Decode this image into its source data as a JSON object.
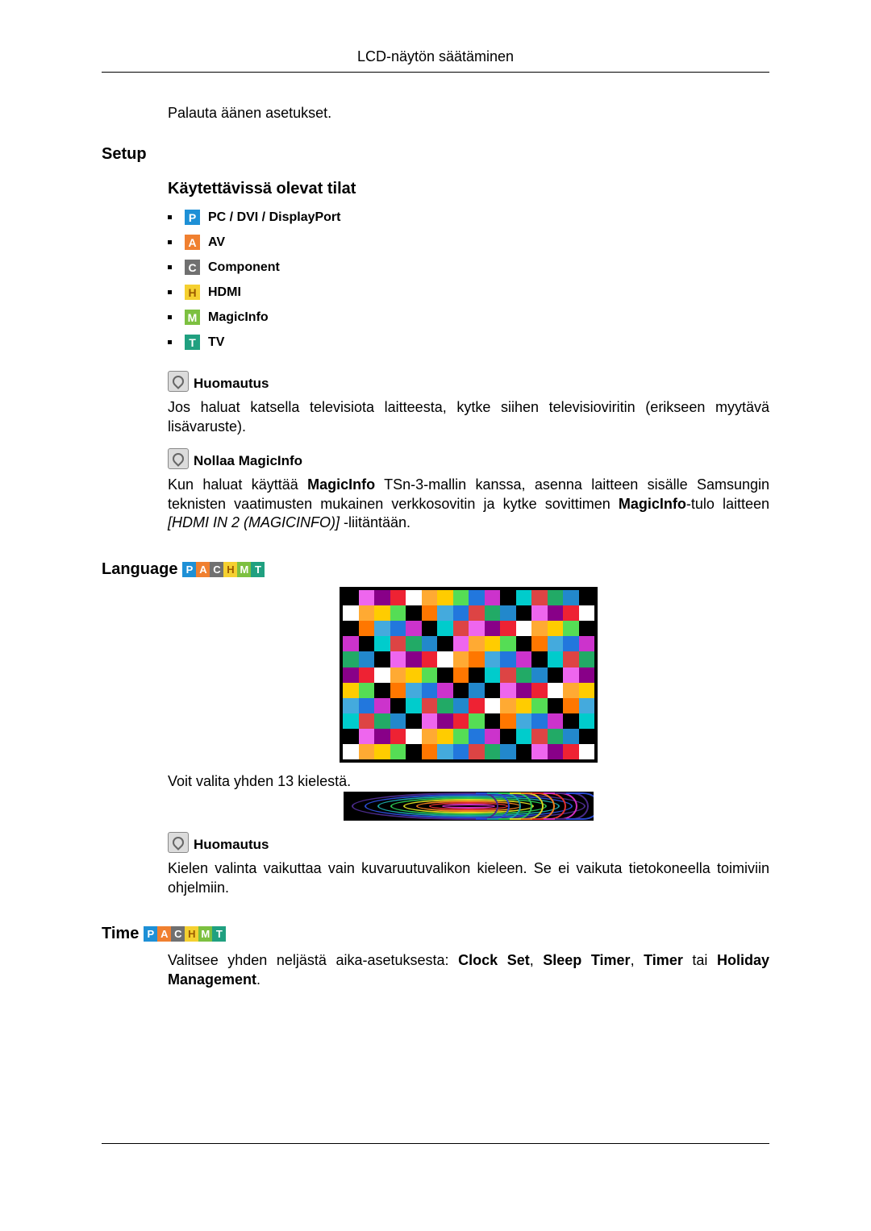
{
  "header": {
    "title": "LCD-näytön säätäminen"
  },
  "sound_reset": "Palauta äänen asetukset.",
  "setup": {
    "heading": "Setup",
    "modes_heading": "Käytettävissä olevat tilat",
    "modes": [
      {
        "badge": "P",
        "label": "PC / DVI / DisplayPort"
      },
      {
        "badge": "A",
        "label": "AV"
      },
      {
        "badge": "C",
        "label": "Component"
      },
      {
        "badge": "H",
        "label": "HDMI"
      },
      {
        "badge": "M",
        "label": "MagicInfo"
      },
      {
        "badge": "T",
        "label": "TV"
      }
    ],
    "note1_label": "Huomautus",
    "note1_text": "Jos haluat katsella televisiota laitteesta, kytke siihen televisioviritin (erikseen myytävä lisävaruste).",
    "note2_label": "Nollaa MagicInfo",
    "note2_text_a": "Kun haluat käyttää ",
    "note2_bold_a": "MagicInfo",
    "note2_text_b": " TSn-3-mallin kanssa, asenna laitteen sisälle Samsungin teknisten vaatimusten mukainen verkkosovitin ja kytke sovittimen ",
    "note2_bold_b": "MagicInfo",
    "note2_text_c": "-tulo laitteen ",
    "note2_italic": "[HDMI IN 2 (MAGICINFO)]",
    "note2_text_d": " -liitäntään."
  },
  "language": {
    "heading": "Language",
    "body": "Voit valita yhden 13 kielestä.",
    "note_label": "Huomautus",
    "note_text": "Kielen valinta vaikuttaa vain kuvaruutuvalikon kieleen. Se ei vaikuta tietokoneella toimiviin ohjelmiin."
  },
  "time": {
    "heading": "Time",
    "text_a": "Valitsee yhden neljästä aika-asetuksesta: ",
    "b1": "Clock Set",
    "s1": ", ",
    "b2": "Sleep Timer",
    "s2": ", ",
    "b3": "Timer",
    "s3": " tai ",
    "b4": "Holiday Management",
    "s4": "."
  }
}
